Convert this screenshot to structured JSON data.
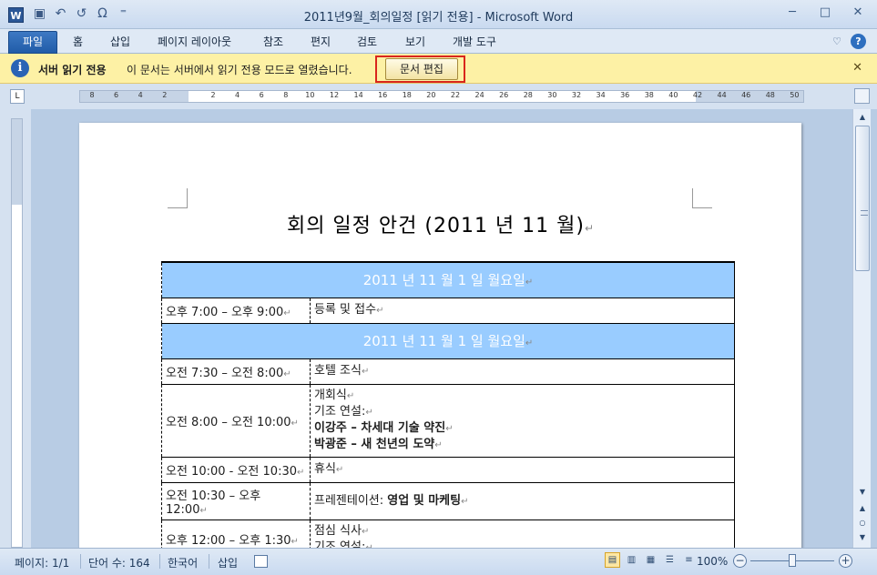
{
  "window": {
    "app_icon": "W",
    "title": "2011년9월_회의일정 [읽기 전용] - Microsoft Word",
    "qat_icons": [
      "save-icon",
      "undo-icon",
      "redo-icon",
      "symbol-icon",
      "customize-qat-icon"
    ],
    "qat_glyphs": [
      "▣",
      "↶",
      "↺",
      "Ω",
      "⁼"
    ],
    "controls": {
      "minimize": "─",
      "maximize": "□",
      "close": "✕"
    }
  },
  "ribbon": {
    "file_tab": "파일",
    "tabs": [
      "홈",
      "삽입",
      "페이지 레이아웃",
      "참조",
      "편지",
      "검토",
      "보기",
      "개발 도구"
    ],
    "help": "?",
    "collapse": "♡"
  },
  "message_bar": {
    "title": "서버 읽기 전용",
    "text": "이 문서는 서버에서 읽기 전용 모드로 열렸습니다.",
    "edit_button": "문서 편집",
    "close": "✕",
    "info_glyph": "i"
  },
  "ruler": {
    "corner": "L",
    "labels": [
      "8",
      "6",
      "4",
      "2",
      "",
      "2",
      "4",
      "6",
      "8",
      "10",
      "12",
      "14",
      "16",
      "18",
      "20",
      "22",
      "24",
      "26",
      "28",
      "30",
      "32",
      "34",
      "36",
      "38",
      "40",
      "42",
      "44",
      "46",
      "48",
      "50"
    ]
  },
  "document": {
    "title": "회의 일정 안건 (2011 년 11 월)",
    "rows": [
      {
        "type": "day",
        "text": "2011 년 11 월 1 일 월요일"
      },
      {
        "type": "item",
        "time": "오후 7:00 – 오후 9:00",
        "lines": [
          {
            "text": "등록 및 접수",
            "bold": false
          }
        ]
      },
      {
        "type": "day",
        "text": "2011 년 11 월 1 일 월요일"
      },
      {
        "type": "item",
        "time": "오전 7:30 – 오전 8:00",
        "lines": [
          {
            "text": "호텔 조식",
            "bold": false
          }
        ]
      },
      {
        "type": "item",
        "time": "오전 8:00 – 오전 10:00",
        "lines": [
          {
            "text": "개회식",
            "bold": false
          },
          {
            "text": "기조 연설:",
            "bold": false
          },
          {
            "text": "이강주 – 차세대 기술 약진",
            "bold": true
          },
          {
            "text": "박광준 – 새 천년의 도약",
            "bold": true
          }
        ]
      },
      {
        "type": "item",
        "time": "오전 10:00  - 오전 10:30",
        "lines": [
          {
            "text": "휴식",
            "bold": false
          }
        ]
      },
      {
        "type": "item",
        "time": "오전 10:30 – 오후 12:00",
        "lines": [
          {
            "text": "프레젠테이션:  ",
            "bold": false,
            "suffix": "영업 및 마케팅"
          }
        ]
      },
      {
        "type": "item",
        "time": "오후 12:00 – 오후 1:30",
        "lines": [
          {
            "text": "점심 식사",
            "bold": false
          },
          {
            "text": "기조 연설:",
            "bold": false
          }
        ]
      }
    ]
  },
  "status_bar": {
    "page": "페이지: 1/1",
    "words": "단어 수: 164",
    "language": "한국어",
    "mode": "삽입",
    "zoom": "100%",
    "zoom_minus": "−",
    "zoom_plus": "+",
    "zoom_level": 1.0,
    "view_glyphs": [
      "▤",
      "▥",
      "▦",
      "☰",
      "≡"
    ]
  },
  "scrollbar": {
    "up": "▲",
    "down": "▼",
    "prev": "▲",
    "select": "○",
    "next": "▼"
  }
}
